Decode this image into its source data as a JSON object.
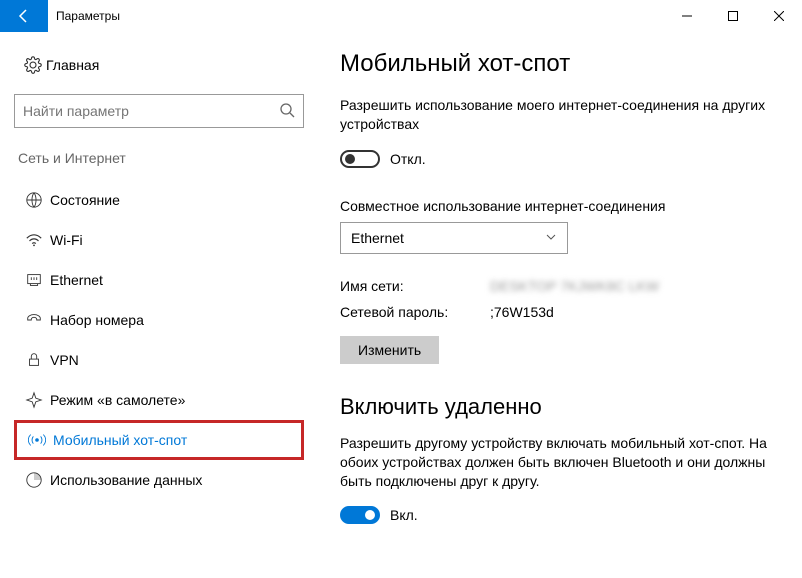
{
  "window": {
    "title": "Параметры"
  },
  "sidebar": {
    "home_label": "Главная",
    "search_placeholder": "Найти параметр",
    "section_label": "Сеть и Интернет",
    "items": [
      {
        "label": "Состояние"
      },
      {
        "label": "Wi-Fi"
      },
      {
        "label": "Ethernet"
      },
      {
        "label": "Набор номера"
      },
      {
        "label": "VPN"
      },
      {
        "label": "Режим «в самолете»"
      },
      {
        "label": "Мобильный хот-спот"
      },
      {
        "label": "Использование данных"
      }
    ]
  },
  "main": {
    "heading": "Мобильный хот-спот",
    "share_desc": "Разрешить использование моего интернет-соединения на других устройствах",
    "share_toggle_label": "Откл.",
    "share_source_label": "Совместное использование интернет-соединения",
    "share_source_value": "Ethernet",
    "net_name_label": "Имя сети:",
    "net_name_value": "DESKTOP 7KJWK8C LKW",
    "net_pass_label": "Сетевой пароль:",
    "net_pass_value": ";76W153d",
    "edit_button": "Изменить",
    "remote_heading": "Включить удаленно",
    "remote_desc": "Разрешить другому устройству включать мобильный хот-спот. На обоих устройствах должен быть включен Bluetooth и они должны быть подключены друг к другу.",
    "remote_toggle_label": "Вкл."
  }
}
